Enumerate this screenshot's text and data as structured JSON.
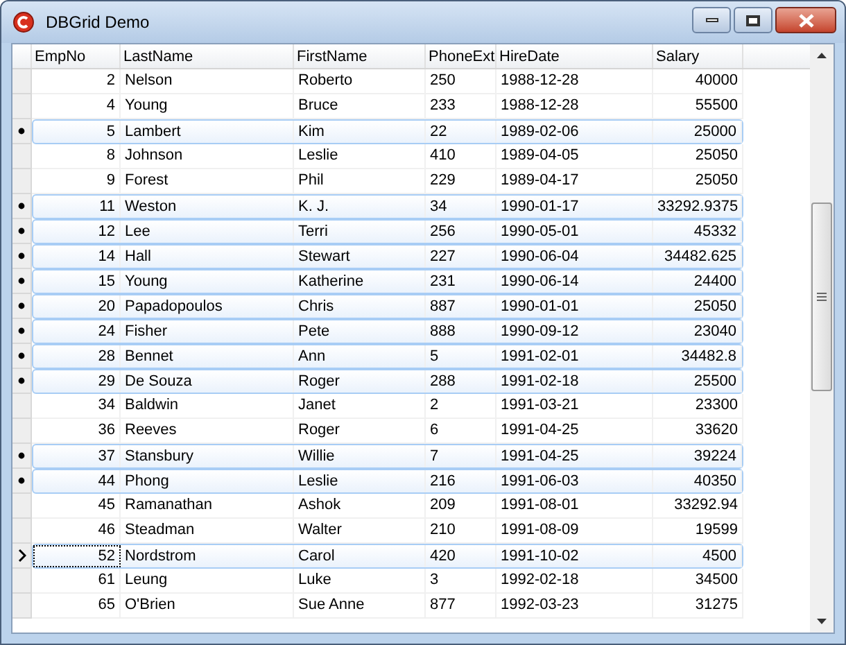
{
  "window": {
    "title": "DBGrid Demo"
  },
  "table": {
    "columns": [
      "EmpNo",
      "LastName",
      "FirstName",
      "PhoneExt",
      "HireDate",
      "Salary"
    ],
    "rows": [
      {
        "cells": [
          "2",
          "Nelson",
          "Roberto",
          "250",
          "1988-12-28",
          "40000"
        ],
        "selected": false,
        "current": false
      },
      {
        "cells": [
          "4",
          "Young",
          "Bruce",
          "233",
          "1988-12-28",
          "55500"
        ],
        "selected": false,
        "current": false
      },
      {
        "cells": [
          "5",
          "Lambert",
          "Kim",
          "22",
          "1989-02-06",
          "25000"
        ],
        "selected": true,
        "current": false
      },
      {
        "cells": [
          "8",
          "Johnson",
          "Leslie",
          "410",
          "1989-04-05",
          "25050"
        ],
        "selected": false,
        "current": false
      },
      {
        "cells": [
          "9",
          "Forest",
          "Phil",
          "229",
          "1989-04-17",
          "25050"
        ],
        "selected": false,
        "current": false
      },
      {
        "cells": [
          "11",
          "Weston",
          "K. J.",
          "34",
          "1990-01-17",
          "33292.9375"
        ],
        "selected": true,
        "current": false
      },
      {
        "cells": [
          "12",
          "Lee",
          "Terri",
          "256",
          "1990-05-01",
          "45332"
        ],
        "selected": true,
        "current": false
      },
      {
        "cells": [
          "14",
          "Hall",
          "Stewart",
          "227",
          "1990-06-04",
          "34482.625"
        ],
        "selected": true,
        "current": false
      },
      {
        "cells": [
          "15",
          "Young",
          "Katherine",
          "231",
          "1990-06-14",
          "24400"
        ],
        "selected": true,
        "current": false
      },
      {
        "cells": [
          "20",
          "Papadopoulos",
          "Chris",
          "887",
          "1990-01-01",
          "25050"
        ],
        "selected": true,
        "current": false
      },
      {
        "cells": [
          "24",
          "Fisher",
          "Pete",
          "888",
          "1990-09-12",
          "23040"
        ],
        "selected": true,
        "current": false
      },
      {
        "cells": [
          "28",
          "Bennet",
          "Ann",
          "5",
          "1991-02-01",
          "34482.8"
        ],
        "selected": true,
        "current": false
      },
      {
        "cells": [
          "29",
          "De Souza",
          "Roger",
          "288",
          "1991-02-18",
          "25500"
        ],
        "selected": true,
        "current": false
      },
      {
        "cells": [
          "34",
          "Baldwin",
          "Janet",
          "2",
          "1991-03-21",
          "23300"
        ],
        "selected": false,
        "current": false
      },
      {
        "cells": [
          "36",
          "Reeves",
          "Roger",
          "6",
          "1991-04-25",
          "33620"
        ],
        "selected": false,
        "current": false
      },
      {
        "cells": [
          "37",
          "Stansbury",
          "Willie",
          "7",
          "1991-04-25",
          "39224"
        ],
        "selected": true,
        "current": false
      },
      {
        "cells": [
          "44",
          "Phong",
          "Leslie",
          "216",
          "1991-06-03",
          "40350"
        ],
        "selected": true,
        "current": false
      },
      {
        "cells": [
          "45",
          "Ramanathan",
          "Ashok",
          "209",
          "1991-08-01",
          "33292.94"
        ],
        "selected": false,
        "current": false
      },
      {
        "cells": [
          "46",
          "Steadman",
          "Walter",
          "210",
          "1991-08-09",
          "19599"
        ],
        "selected": false,
        "current": false
      },
      {
        "cells": [
          "52",
          "Nordstrom",
          "Carol",
          "420",
          "1991-10-02",
          "4500"
        ],
        "selected": false,
        "current": true
      },
      {
        "cells": [
          "61",
          "Leung",
          "Luke",
          "3",
          "1992-02-18",
          "34500"
        ],
        "selected": false,
        "current": false
      },
      {
        "cells": [
          "65",
          "O'Brien",
          "Sue Anne",
          "877",
          "1992-03-23",
          "31275"
        ],
        "selected": false,
        "current": false
      }
    ]
  }
}
